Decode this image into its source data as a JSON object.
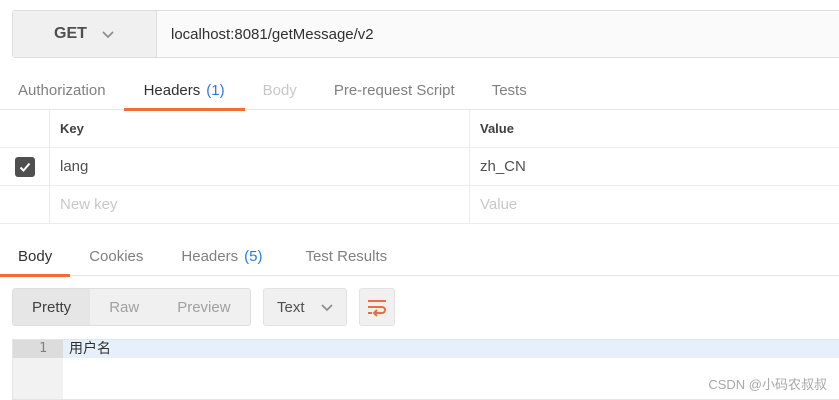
{
  "request": {
    "method": "GET",
    "url": "localhost:8081/getMessage/v2"
  },
  "request_tabs": [
    {
      "label": "Authorization",
      "count": ""
    },
    {
      "label": "Headers",
      "count": "(1)"
    },
    {
      "label": "Body",
      "count": ""
    },
    {
      "label": "Pre-request Script",
      "count": ""
    },
    {
      "label": "Tests",
      "count": ""
    }
  ],
  "headers_table": {
    "columns": [
      "Key",
      "Value"
    ],
    "rows": [
      {
        "checked": true,
        "key": "lang",
        "value": "zh_CN"
      }
    ],
    "new_key_placeholder": "New key",
    "new_value_placeholder": "Value"
  },
  "response_tabs": [
    {
      "label": "Body",
      "count": ""
    },
    {
      "label": "Cookies",
      "count": ""
    },
    {
      "label": "Headers",
      "count": "(5)"
    },
    {
      "label": "Test Results",
      "count": ""
    }
  ],
  "view_modes": [
    "Pretty",
    "Raw",
    "Preview"
  ],
  "format": "Text",
  "response_body": {
    "line_number": "1",
    "text": "用户名"
  },
  "watermark": "CSDN @小码农叔叔",
  "colors": {
    "accent": "#f26b3a",
    "count": "#2b7bd6"
  }
}
